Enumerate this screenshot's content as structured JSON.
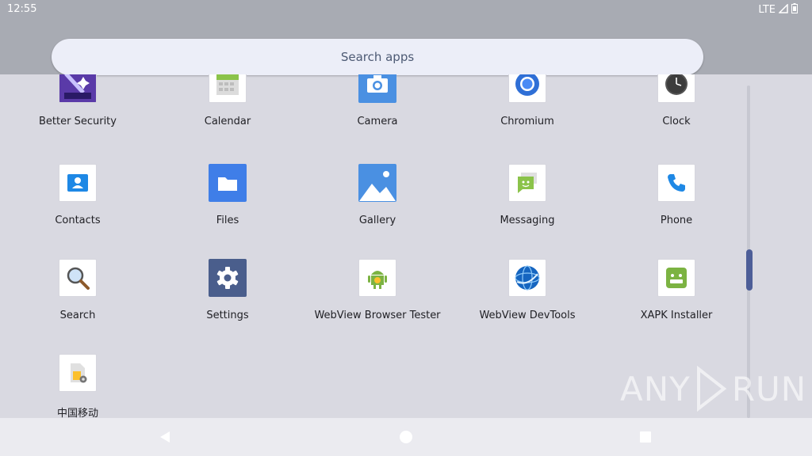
{
  "status": {
    "time": "12:55",
    "network": "LTE"
  },
  "search": {
    "placeholder": "Search apps"
  },
  "apps": [
    {
      "label": "Better Security",
      "icon": "shield-magic-icon"
    },
    {
      "label": "Calendar",
      "icon": "calendar-icon"
    },
    {
      "label": "Camera",
      "icon": "camera-icon"
    },
    {
      "label": "Chromium",
      "icon": "chromium-icon"
    },
    {
      "label": "Clock",
      "icon": "clock-icon"
    },
    {
      "label": "Contacts",
      "icon": "contacts-icon"
    },
    {
      "label": "Files",
      "icon": "folder-icon"
    },
    {
      "label": "Gallery",
      "icon": "gallery-icon"
    },
    {
      "label": "Messaging",
      "icon": "messaging-icon"
    },
    {
      "label": "Phone",
      "icon": "phone-icon"
    },
    {
      "label": "Search",
      "icon": "magnifier-icon"
    },
    {
      "label": "Settings",
      "icon": "gear-icon"
    },
    {
      "label": "WebView Browser Tester",
      "icon": "android-robot-icon"
    },
    {
      "label": "WebView DevTools",
      "icon": "globe-icon"
    },
    {
      "label": "XAPK Installer",
      "icon": "xapk-icon"
    },
    {
      "label": "中国移动",
      "icon": "sim-card-icon"
    }
  ],
  "watermark": {
    "text": "ANY  RUN"
  }
}
